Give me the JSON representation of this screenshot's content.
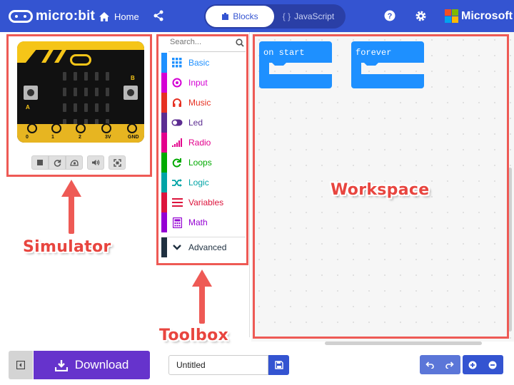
{
  "header": {
    "logo_text": "micro:bit",
    "home_label": "Home",
    "share_icon": "share-icon",
    "mode_blocks_label": "Blocks",
    "mode_js_label": "JavaScript",
    "mode_js_glyph": "{ }",
    "help_icon": "help-icon",
    "settings_icon": "gear-icon",
    "brand_label": "Microsoft",
    "colors": {
      "bar": "#3454d1",
      "toggle_bg": "#2a3fa6"
    }
  },
  "simulator": {
    "button_a_label": "A",
    "button_b_label": "B",
    "pins": [
      "0",
      "1",
      "2",
      "3V",
      "GND"
    ],
    "controls": [
      "stop-icon",
      "restart-icon",
      "slow-motion-icon",
      "sound-icon",
      "fullscreen-icon"
    ]
  },
  "toolbox": {
    "search_placeholder": "Search...",
    "categories": [
      {
        "label": "Basic",
        "color": "#1e90ff",
        "icon": "grid-icon"
      },
      {
        "label": "Input",
        "color": "#d400d4",
        "icon": "target-icon"
      },
      {
        "label": "Music",
        "color": "#e63022",
        "icon": "headphones-icon"
      },
      {
        "label": "Led",
        "color": "#5c2d91",
        "icon": "toggle-icon"
      },
      {
        "label": "Radio",
        "color": "#e3008c",
        "icon": "signal-bars-icon"
      },
      {
        "label": "Loops",
        "color": "#00aa00",
        "icon": "loop-arrow-icon"
      },
      {
        "label": "Logic",
        "color": "#00a4a6",
        "icon": "shuffle-icon"
      },
      {
        "label": "Variables",
        "color": "#dc143c",
        "icon": "list-lines-icon"
      },
      {
        "label": "Math",
        "color": "#9400d3",
        "icon": "calculator-icon"
      }
    ],
    "advanced": {
      "label": "Advanced",
      "color": "#1f3040",
      "icon": "chevron-down-icon"
    }
  },
  "workspace": {
    "blocks": [
      {
        "label": "on start",
        "color": "#1e90ff"
      },
      {
        "label": "forever",
        "color": "#1e90ff"
      }
    ]
  },
  "annotations": {
    "simulator": "Simulator",
    "toolbox": "Toolbox",
    "workspace": "Workspace",
    "color": "#ee5a55"
  },
  "footer": {
    "download_label": "Download",
    "project_name": "Untitled",
    "colors": {
      "download": "#6633cc",
      "save": "#3454d1"
    }
  }
}
